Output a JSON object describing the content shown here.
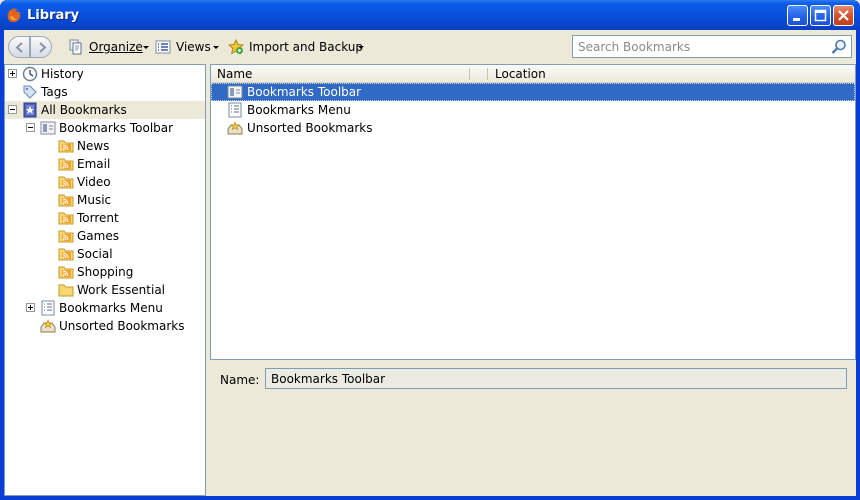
{
  "window": {
    "title": "Library"
  },
  "toolbar": {
    "organize_label": "Organize",
    "views_label": "Views",
    "import_label": "Import and Backup",
    "search_placeholder": "Search Bookmarks"
  },
  "tree": {
    "history": "History",
    "tags": "Tags",
    "all_bookmarks": "All Bookmarks",
    "bookmarks_toolbar": "Bookmarks Toolbar",
    "toolbar_children": [
      "News",
      "Email",
      "Video",
      "Music",
      "Torrent",
      "Games",
      "Social",
      "Shopping",
      "Work Essential"
    ],
    "bookmarks_menu": "Bookmarks Menu",
    "unsorted": "Unsorted Bookmarks"
  },
  "list": {
    "columns": [
      "Name",
      "Location"
    ],
    "rows": [
      "Bookmarks Toolbar",
      "Bookmarks Menu",
      "Unsorted Bookmarks"
    ]
  },
  "details": {
    "name_label": "Name:",
    "name_value": "Bookmarks Toolbar"
  },
  "colors": {
    "selection": "#316ac5",
    "titlebar": "#0a51de",
    "feed_folder": "#f0a22e"
  }
}
